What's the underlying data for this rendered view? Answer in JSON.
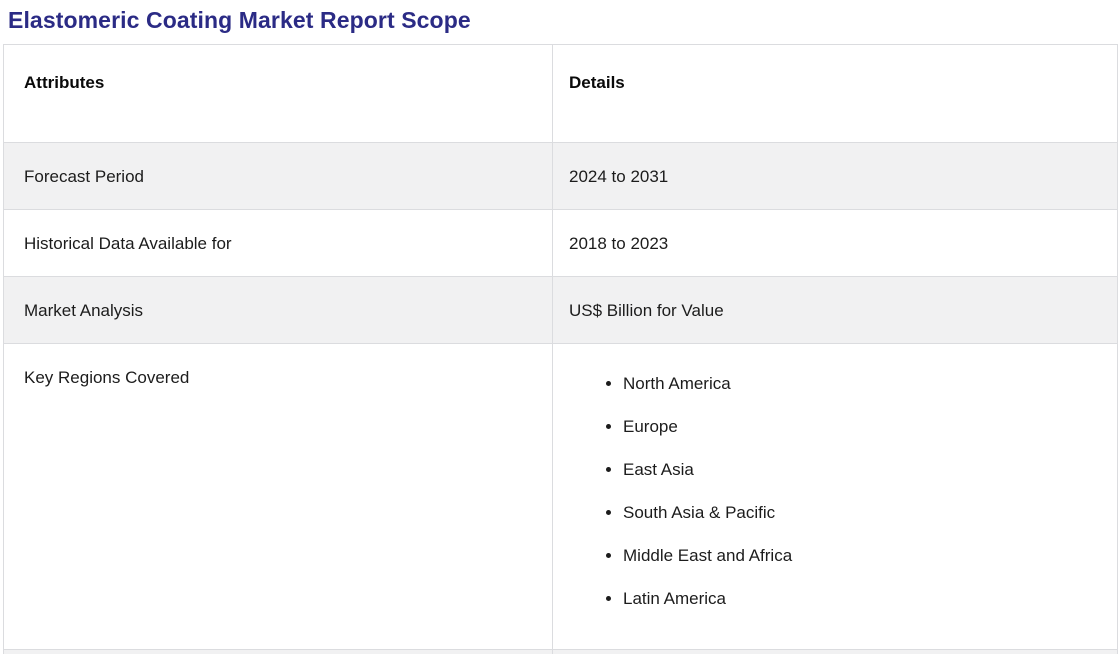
{
  "page": {
    "title": "Elastomeric Coating Market Report Scope"
  },
  "table": {
    "headers": {
      "attributes": "Attributes",
      "details": "Details"
    },
    "rows": [
      {
        "attribute": "Forecast Period",
        "detail": "2024 to 2031"
      },
      {
        "attribute": "Historical Data Available for",
        "detail": "2018 to 2023"
      },
      {
        "attribute": "Market Analysis",
        "detail": "US$ Billion for Value"
      },
      {
        "attribute": "Key Regions Covered",
        "detail_list": [
          "North America",
          "Europe",
          "East Asia",
          "South Asia & Pacific",
          "Middle East and Africa",
          "Latin America"
        ]
      }
    ]
  },
  "colors": {
    "title": "#2b2b85",
    "row_alt_background": "#f1f1f2",
    "border": "#dbdcdf",
    "text": "#1c1c1c"
  }
}
